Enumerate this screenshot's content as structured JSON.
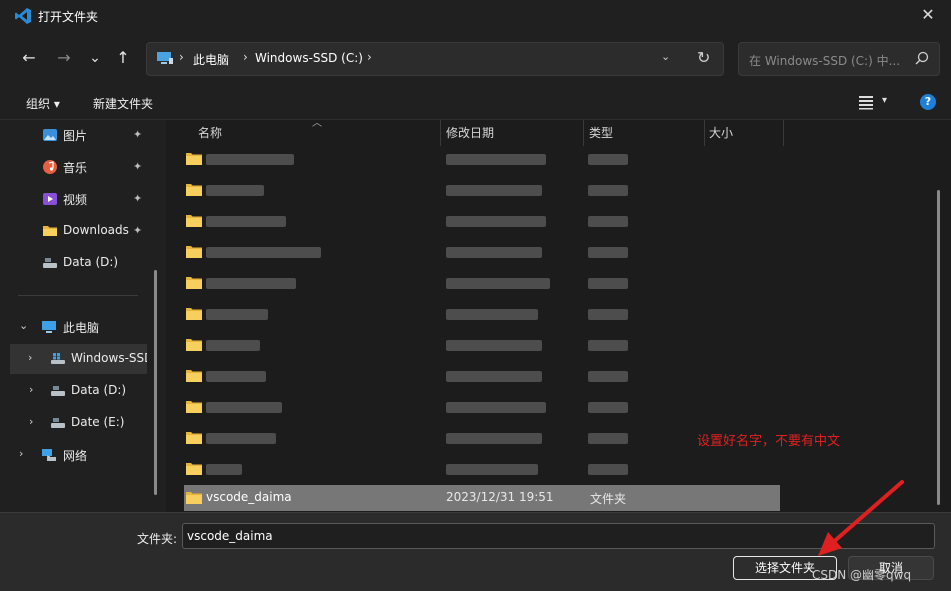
{
  "window": {
    "title": "打开文件夹",
    "close_glyph": "✕",
    "app_icon": "vscode-icon"
  },
  "nav": {
    "back_glyph": "←",
    "forward_glyph": "→",
    "recent_glyph": "⌄",
    "up_glyph": "↑",
    "breadcrumb": [
      "此电脑",
      "Windows-SSD (C:)"
    ],
    "chevron": "›",
    "dropdown_glyph": "⌄",
    "refresh_glyph": "↻",
    "search_placeholder": "在 Windows-SSD (C:) 中..."
  },
  "toolbar": {
    "organize_label": "组织 ▾",
    "new_folder_label": "新建文件夹",
    "view_caret": "▾",
    "help_glyph": "?"
  },
  "sidebar": {
    "quick_access": [
      {
        "label": "图片",
        "icon": "pictures-icon",
        "pinned": true
      },
      {
        "label": "音乐",
        "icon": "music-icon",
        "pinned": true
      },
      {
        "label": "视频",
        "icon": "videos-icon",
        "pinned": true
      },
      {
        "label": "Downloads",
        "icon": "folder-icon",
        "pinned": true
      },
      {
        "label": "Data (D:)",
        "icon": "drive-icon",
        "pinned": false
      }
    ],
    "pin_glyph": "📌",
    "pc": {
      "label": "此电脑",
      "expand_glyph": "⌄",
      "drives": [
        {
          "label": "Windows-SSD (C:)",
          "selected": true
        },
        {
          "label": "Data (D:)",
          "selected": false
        },
        {
          "label": "Date (E:)",
          "selected": false
        }
      ]
    },
    "network": {
      "label": "网络"
    },
    "collapsed_glyph": "›"
  },
  "columns": {
    "name": "名称",
    "modified": "修改日期",
    "type": "类型",
    "size": "大小",
    "sort_glyph": "︿"
  },
  "files": {
    "selected": {
      "name": "vscode_daima",
      "modified": "2023/12/31 19:51",
      "type": "文件夹"
    }
  },
  "footer": {
    "folder_label": "文件夹:",
    "folder_value": "vscode_daima",
    "select_button": "选择文件夹",
    "cancel_button": "取消"
  },
  "annotation": {
    "text": "设置好名字，不要有中文",
    "color": "#e02020"
  },
  "watermark": "CSDN @幽零qwq"
}
